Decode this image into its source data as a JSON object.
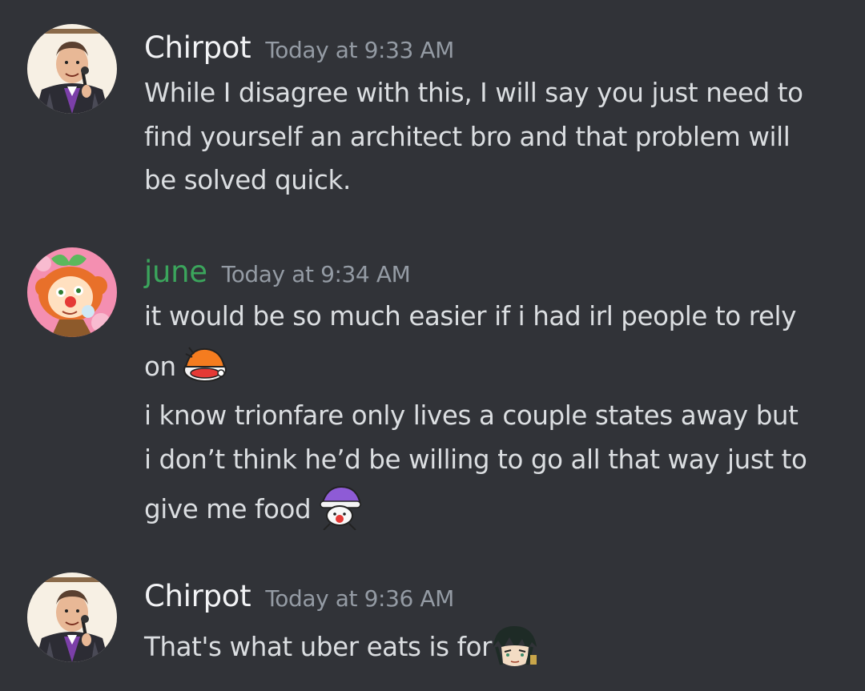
{
  "messages": [
    {
      "author": "Chirpot",
      "author_color": "#f2f3f5",
      "avatar": "man-with-microphone-avatar",
      "timestamp": "Today at 9:33 AM",
      "lines": [
        "While I disagree with this, I will say you just need to",
        "find yourself an architect bro and that problem will",
        "be solved quick."
      ]
    },
    {
      "author": "june",
      "author_color": "#3ba55c",
      "avatar": "clown-girl-avatar",
      "timestamp": "Today at 9:34 AM",
      "lines": [
        "it would be so much easier if i had irl people to rely",
        "on"
      ],
      "lines_2": [
        "i know trionfare only lives a couple states away but",
        "i don’t think he’d be willing to go all that way just to",
        "give me food"
      ],
      "emojis": [
        "orange-hat-creature-emoji",
        "purple-hat-clown-emoji"
      ]
    },
    {
      "author": "Chirpot",
      "author_color": "#f2f3f5",
      "avatar": "man-with-microphone-avatar",
      "timestamp": "Today at 9:36 AM",
      "lines": [
        "That's what uber eats is for"
      ],
      "emojis": [
        "anime-character-face-emoji"
      ]
    }
  ]
}
